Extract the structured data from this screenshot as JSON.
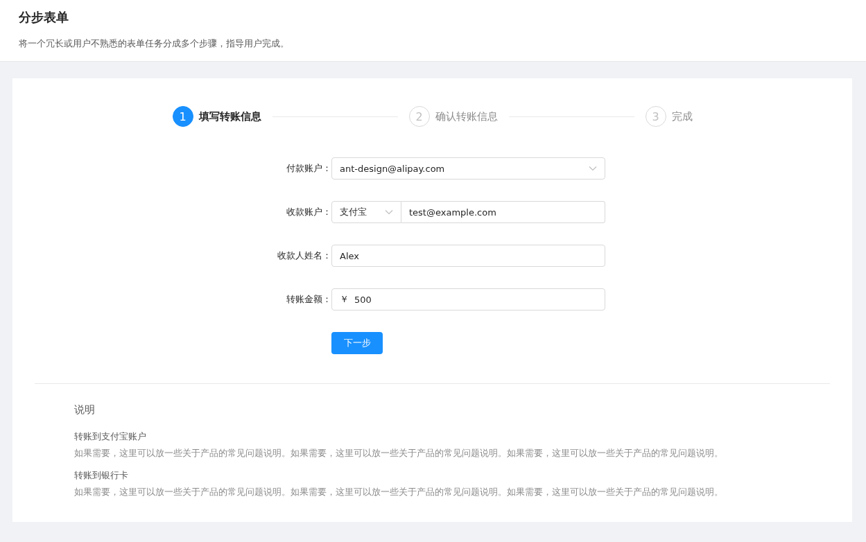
{
  "page_header": {
    "title": "分步表单",
    "description": "将一个冗长或用户不熟悉的表单任务分成多个步骤，指导用户完成。"
  },
  "steps": [
    {
      "number": "1",
      "title": "填写转账信息",
      "selected": true
    },
    {
      "number": "2",
      "title": "确认转账信息",
      "selected": false
    },
    {
      "number": "3",
      "title": "完成",
      "selected": false
    }
  ],
  "form": {
    "fields": [
      {
        "kind": "select",
        "label": "付款账户：",
        "value": "ant-design@alipay.com"
      },
      {
        "kind": "select-input",
        "label": "收款账户：",
        "select_value": "支付宝",
        "value": "test@example.com"
      },
      {
        "kind": "input",
        "label": "收款人姓名：",
        "value": "Alex"
      },
      {
        "kind": "prefix-input",
        "label": "转账金额：",
        "prefix": "￥",
        "value": "500"
      }
    ],
    "submit": "下一步"
  },
  "help": {
    "title": "说明",
    "sections": [
      {
        "heading": "转账到支付宝账户",
        "text": "如果需要，这里可以放一些关于产品的常见问题说明。如果需要，这里可以放一些关于产品的常见问题说明。如果需要，这里可以放一些关于产品的常见问题说明。"
      },
      {
        "heading": "转账到银行卡",
        "text": "如果需要，这里可以放一些关于产品的常见问题说明。如果需要，这里可以放一些关于产品的常见问题说明。如果需要，这里可以放一些关于产品的常见问题说明。"
      }
    ]
  }
}
